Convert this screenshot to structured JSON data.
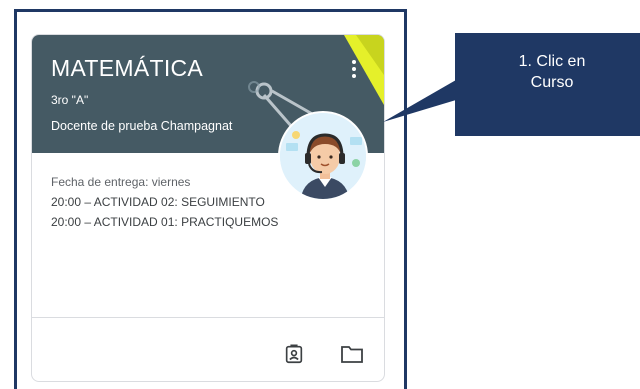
{
  "card": {
    "title": "MATEMÁTICA",
    "section": "3ro \"A\"",
    "teacher": "Docente de prueba Champagnat",
    "due_label": "Fecha de entrega: viernes",
    "assignments": [
      "20:00 – ACTIVIDAD 02: SEGUIMIENTO",
      "20:00 – ACTIVIDAD 01: PRACTIQUEMOS"
    ],
    "footer_icons": [
      "assignment-ind-icon",
      "folder-icon"
    ]
  },
  "callout": {
    "line1": "1. Clic en",
    "line2": "Curso"
  },
  "colors": {
    "header_bg": "#455a64",
    "frame": "#1f3864",
    "callout_bg": "#1f3864",
    "accent_yellow": "#e5f02a"
  }
}
